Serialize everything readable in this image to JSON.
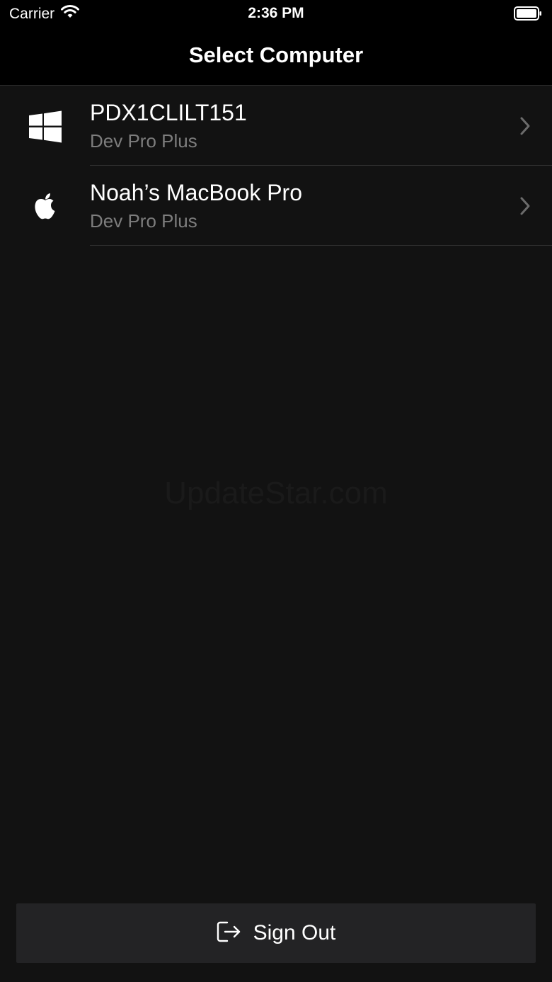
{
  "status_bar": {
    "carrier": "Carrier",
    "time": "2:36 PM"
  },
  "nav": {
    "title": "Select Computer"
  },
  "computers": [
    {
      "name": "PDX1CLILT151",
      "plan": "Dev Pro Plus",
      "os_icon": "windows-icon"
    },
    {
      "name": "Noah’s MacBook Pro",
      "plan": "Dev Pro Plus",
      "os_icon": "apple-icon"
    }
  ],
  "watermark": "UpdateStar.com",
  "footer": {
    "sign_out_label": "Sign Out",
    "sign_out_icon": "sign-out-icon"
  }
}
